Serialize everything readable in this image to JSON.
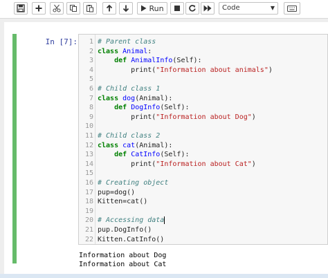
{
  "toolbar": {
    "run_label": "Run",
    "cell_type": "Code",
    "buttons": [
      "save-icon",
      "plus-icon",
      "scissors-icon",
      "copy-icon",
      "paste-icon",
      "arrow-up-icon",
      "arrow-down-icon",
      "play-icon",
      "stop-icon",
      "restart-icon",
      "fast-forward-icon",
      "chevron-down-icon",
      "keyboard-icon"
    ]
  },
  "cell": {
    "prompt": "In [7]:",
    "lines": [
      {
        "n": "1",
        "tokens": [
          {
            "t": "# Parent class",
            "c": "cm"
          }
        ]
      },
      {
        "n": "2",
        "tokens": [
          {
            "t": "class",
            "c": "kw"
          },
          {
            "t": " "
          },
          {
            "t": "Animal",
            "c": "cls"
          },
          {
            "t": ":"
          }
        ]
      },
      {
        "n": "3",
        "tokens": [
          {
            "t": "    "
          },
          {
            "t": "def",
            "c": "kw"
          },
          {
            "t": " "
          },
          {
            "t": "AnimalInfo",
            "c": "fn"
          },
          {
            "t": "(Self):"
          }
        ]
      },
      {
        "n": "4",
        "tokens": [
          {
            "t": "        print("
          },
          {
            "t": "\"Information about animals\"",
            "c": "str"
          },
          {
            "t": ")"
          }
        ]
      },
      {
        "n": "5",
        "tokens": []
      },
      {
        "n": "6",
        "tokens": [
          {
            "t": "# Child class 1",
            "c": "cm"
          }
        ]
      },
      {
        "n": "7",
        "tokens": [
          {
            "t": "class",
            "c": "kw"
          },
          {
            "t": " "
          },
          {
            "t": "dog",
            "c": "cls"
          },
          {
            "t": "(Animal):"
          }
        ]
      },
      {
        "n": "8",
        "tokens": [
          {
            "t": "    "
          },
          {
            "t": "def",
            "c": "kw"
          },
          {
            "t": " "
          },
          {
            "t": "DogInfo",
            "c": "fn"
          },
          {
            "t": "(Self):"
          }
        ]
      },
      {
        "n": "9",
        "tokens": [
          {
            "t": "        print("
          },
          {
            "t": "\"Information about Dog\"",
            "c": "str"
          },
          {
            "t": ")"
          }
        ]
      },
      {
        "n": "10",
        "tokens": []
      },
      {
        "n": "11",
        "tokens": [
          {
            "t": "# Child class 2",
            "c": "cm"
          }
        ]
      },
      {
        "n": "12",
        "tokens": [
          {
            "t": "class",
            "c": "kw"
          },
          {
            "t": " "
          },
          {
            "t": "cat",
            "c": "cls"
          },
          {
            "t": "(Animal):"
          }
        ]
      },
      {
        "n": "13",
        "tokens": [
          {
            "t": "    "
          },
          {
            "t": "def",
            "c": "kw"
          },
          {
            "t": " "
          },
          {
            "t": "CatInfo",
            "c": "fn"
          },
          {
            "t": "(Self):"
          }
        ]
      },
      {
        "n": "14",
        "tokens": [
          {
            "t": "        print("
          },
          {
            "t": "\"Information about Cat\"",
            "c": "str"
          },
          {
            "t": ")"
          }
        ]
      },
      {
        "n": "15",
        "tokens": []
      },
      {
        "n": "16",
        "tokens": [
          {
            "t": "# Creating object",
            "c": "cm"
          }
        ]
      },
      {
        "n": "17",
        "tokens": [
          {
            "t": "pup=dog()"
          }
        ]
      },
      {
        "n": "18",
        "tokens": [
          {
            "t": "Kitten=cat()"
          }
        ]
      },
      {
        "n": "19",
        "tokens": []
      },
      {
        "n": "20",
        "tokens": [
          {
            "t": "# Accessing data",
            "c": "cm"
          }
        ],
        "cursor": true
      },
      {
        "n": "21",
        "tokens": [
          {
            "t": "pup.DogInfo()"
          }
        ]
      },
      {
        "n": "22",
        "tokens": [
          {
            "t": "Kitten.CatInfo()"
          }
        ]
      }
    ]
  },
  "output": {
    "lines": [
      "Information about Dog",
      "Information about Cat"
    ]
  },
  "colors": {
    "keyword": "#008000",
    "function": "#0000ff",
    "string": "#ba2121",
    "comment": "#408080",
    "cell_border": "#66bb6a",
    "prompt": "#303f9f"
  }
}
